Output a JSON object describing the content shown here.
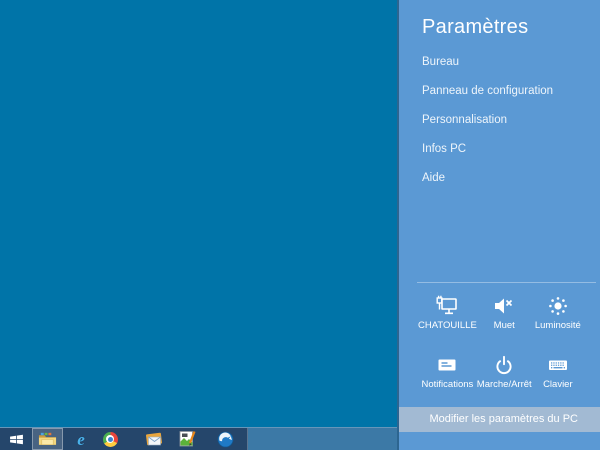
{
  "panel": {
    "title": "Paramètres",
    "menu_items": [
      {
        "label": "Bureau"
      },
      {
        "label": "Panneau de configuration"
      },
      {
        "label": "Personnalisation"
      },
      {
        "label": "Infos PC"
      },
      {
        "label": "Aide"
      }
    ],
    "tiles": [
      {
        "label": "CHATOUILLE",
        "icon": "network-icon"
      },
      {
        "label": "Muet",
        "icon": "mute-icon"
      },
      {
        "label": "Luminosité",
        "icon": "brightness-icon"
      },
      {
        "label": "Notifications",
        "icon": "notifications-icon"
      },
      {
        "label": "Marche/Arrêt",
        "icon": "power-icon"
      },
      {
        "label": "Clavier",
        "icon": "keyboard-icon"
      }
    ],
    "footer_link": "Modifier les paramètres du PC"
  },
  "taskbar": {
    "icons": [
      {
        "name": "windows-start-icon"
      },
      {
        "name": "file-explorer-icon",
        "active": "true"
      },
      {
        "name": "internet-explorer-icon"
      },
      {
        "name": "google-chrome-icon"
      },
      {
        "name": "mail-icon"
      },
      {
        "name": "photo-editor-icon"
      },
      {
        "name": "thunderbird-icon"
      }
    ]
  },
  "colors": {
    "desktop": "#0074a8",
    "panel": "#5b99d4",
    "panel_footer": "#a2bad3",
    "taskbar_dark": "#25466b",
    "taskbar_light": "#3c79a6",
    "icon_foreground": "#ffffff"
  }
}
